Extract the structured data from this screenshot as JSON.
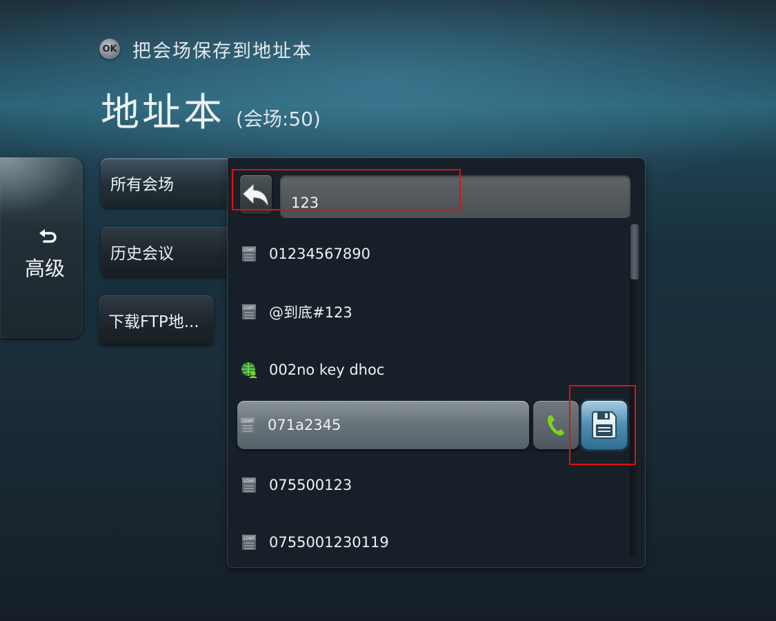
{
  "hint": {
    "ok_label": "OK",
    "text": "把会场保存到地址本"
  },
  "title": {
    "main": "地址本",
    "sub": "(会场:50)"
  },
  "advanced": {
    "label": "高级"
  },
  "tabs": [
    {
      "label": "所有会场",
      "active": true
    },
    {
      "label": "历史会议",
      "active": false
    },
    {
      "label": "下载FTP地...",
      "active": false
    }
  ],
  "search": {
    "value": "123"
  },
  "entries": [
    {
      "text": "01234567890",
      "icon": "ldap-icon"
    },
    {
      "text": "@到底#123",
      "icon": "ldap-icon"
    },
    {
      "text": "002no key dhoc",
      "icon": "globe-users-icon"
    },
    {
      "text": "071a2345",
      "icon": "ldap-icon",
      "selected": true
    },
    {
      "text": "075500123",
      "icon": "ldap-icon"
    },
    {
      "text": "0755001230119",
      "icon": "ldap-icon"
    }
  ],
  "colors": {
    "highlight_border": "#e01010",
    "call_icon": "#7ed321",
    "save_button": "#4e8db0"
  }
}
